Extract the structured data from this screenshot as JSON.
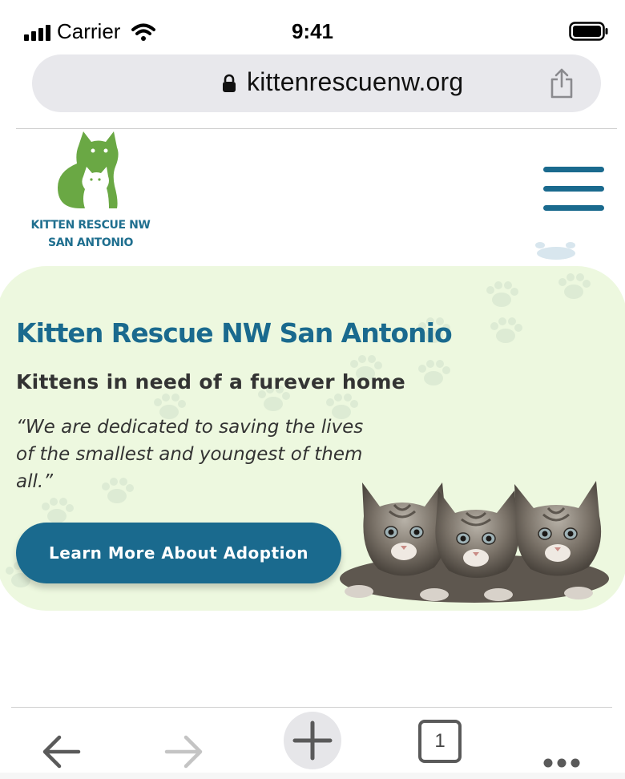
{
  "status_bar": {
    "carrier": "Carrier",
    "time": "9:41"
  },
  "browser": {
    "url": "kittenrescuenw.org",
    "open_tabs_count": "1",
    "icons": {
      "lock": "lock-icon",
      "share": "share-icon",
      "back": "back-arrow-icon",
      "forward": "forward-arrow-icon",
      "new_tab": "plus-icon",
      "tabs": "tabs-icon",
      "more": "more-dots-icon"
    }
  },
  "site": {
    "logo_line1": "KITTEN RESCUE NW",
    "logo_line2": "SAN ANTONIO",
    "menu_icon": "hamburger-menu-icon"
  },
  "hero": {
    "title": "Kitten Rescue NW San Antonio",
    "subtitle": "Kittens in need of a furever home",
    "quote": "“We are dedicated to saving the lives of the smallest and youngest of them all.”",
    "cta_label": "Learn More About Adoption"
  },
  "colors": {
    "brand_blue": "#1a6a8e",
    "brand_green": "#6aa844",
    "hero_bg": "#edf8df"
  }
}
